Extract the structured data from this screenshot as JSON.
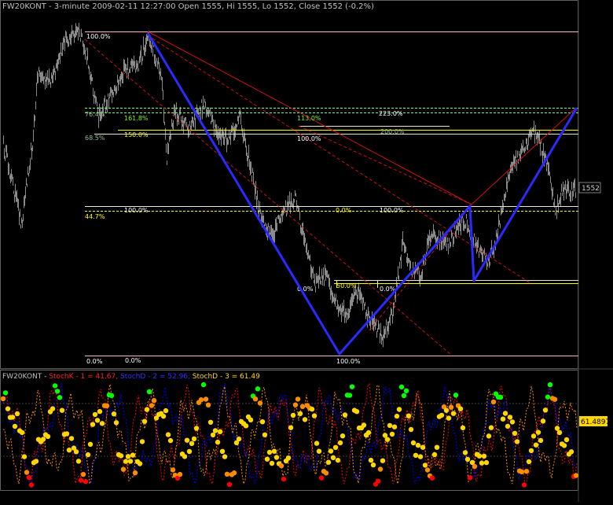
{
  "header": {
    "title": "FW20KONT - 3-minute 2009-02-11 12:27:00 Open 1555, Hi 1555, Lo 1552, Close 1552 (-0.2%)"
  },
  "colors": {
    "background": "#000000",
    "price": "#8a8a8a",
    "wave": "#2a2aff",
    "fib_white": "#e8e8d0",
    "fib_pink": "#ffb6c1",
    "fib_green": "#7cfc7c",
    "fib_yellow": "#ffff00",
    "trend_red": "#d01010",
    "stoch_k": "#ff0000",
    "stoch_d": "#0000ff",
    "stoch_d3": "#ffd700",
    "osc_high": "#00ff00",
    "osc_mid": "#ff8c00",
    "osc_low": "#ff0000"
  },
  "chart_data": [
    {
      "type": "line",
      "series": [
        {
          "name": "FW20KONT",
          "values": [
            1552
          ]
        }
      ],
      "last_price_label": "1552",
      "fib_labels": [
        {
          "text": "100.0%",
          "color": "#ffffff"
        },
        {
          "text": "76.4%",
          "color": "#8fbc8f"
        },
        {
          "text": "161.8%",
          "color": "#7cfc00"
        },
        {
          "text": "113.0%",
          "color": "#7cfc00"
        },
        {
          "text": "223.0%",
          "color": "#ffffff"
        },
        {
          "text": "68.5%",
          "color": "#8fbc8f"
        },
        {
          "text": "150.0%",
          "color": "#ffff00"
        },
        {
          "text": "100.0%",
          "color": "#ffffff"
        },
        {
          "text": "200.0%",
          "color": "#8fbc8f"
        },
        {
          "text": "44.7%",
          "color": "#ffff00"
        },
        {
          "text": "100.0%",
          "color": "#ffffff"
        },
        {
          "text": "0.0%",
          "color": "#ffff00"
        },
        {
          "text": "100.0%",
          "color": "#ffffff"
        },
        {
          "text": "0.0%",
          "color": "#ffffff"
        },
        {
          "text": "50.0%",
          "color": "#ffff00"
        },
        {
          "text": "0.0%",
          "color": "#ffffff"
        },
        {
          "text": "0.0%",
          "color": "#ffffff"
        },
        {
          "text": "0.0%",
          "color": "#ffffff"
        },
        {
          "text": "100.0%",
          "color": "#ffffff"
        }
      ]
    },
    {
      "type": "line",
      "title_parts": [
        {
          "text": "FW20KONT - ",
          "color": "#c0c0c0"
        },
        {
          "text": "StochK - 1 = 41.67, ",
          "color": "#ff2020"
        },
        {
          "text": "StochD - 2 = 52.96, ",
          "color": "#3030ff"
        },
        {
          "text": "StochD - 3 = 61.49",
          "color": "#ffd700"
        }
      ],
      "series": [
        {
          "name": "StochK - 1",
          "values": [
            41.67
          ]
        },
        {
          "name": "StochD - 2",
          "values": [
            52.96
          ]
        },
        {
          "name": "StochD - 3",
          "values": [
            61.49
          ]
        }
      ],
      "last_value_label": "61.4897"
    }
  ]
}
